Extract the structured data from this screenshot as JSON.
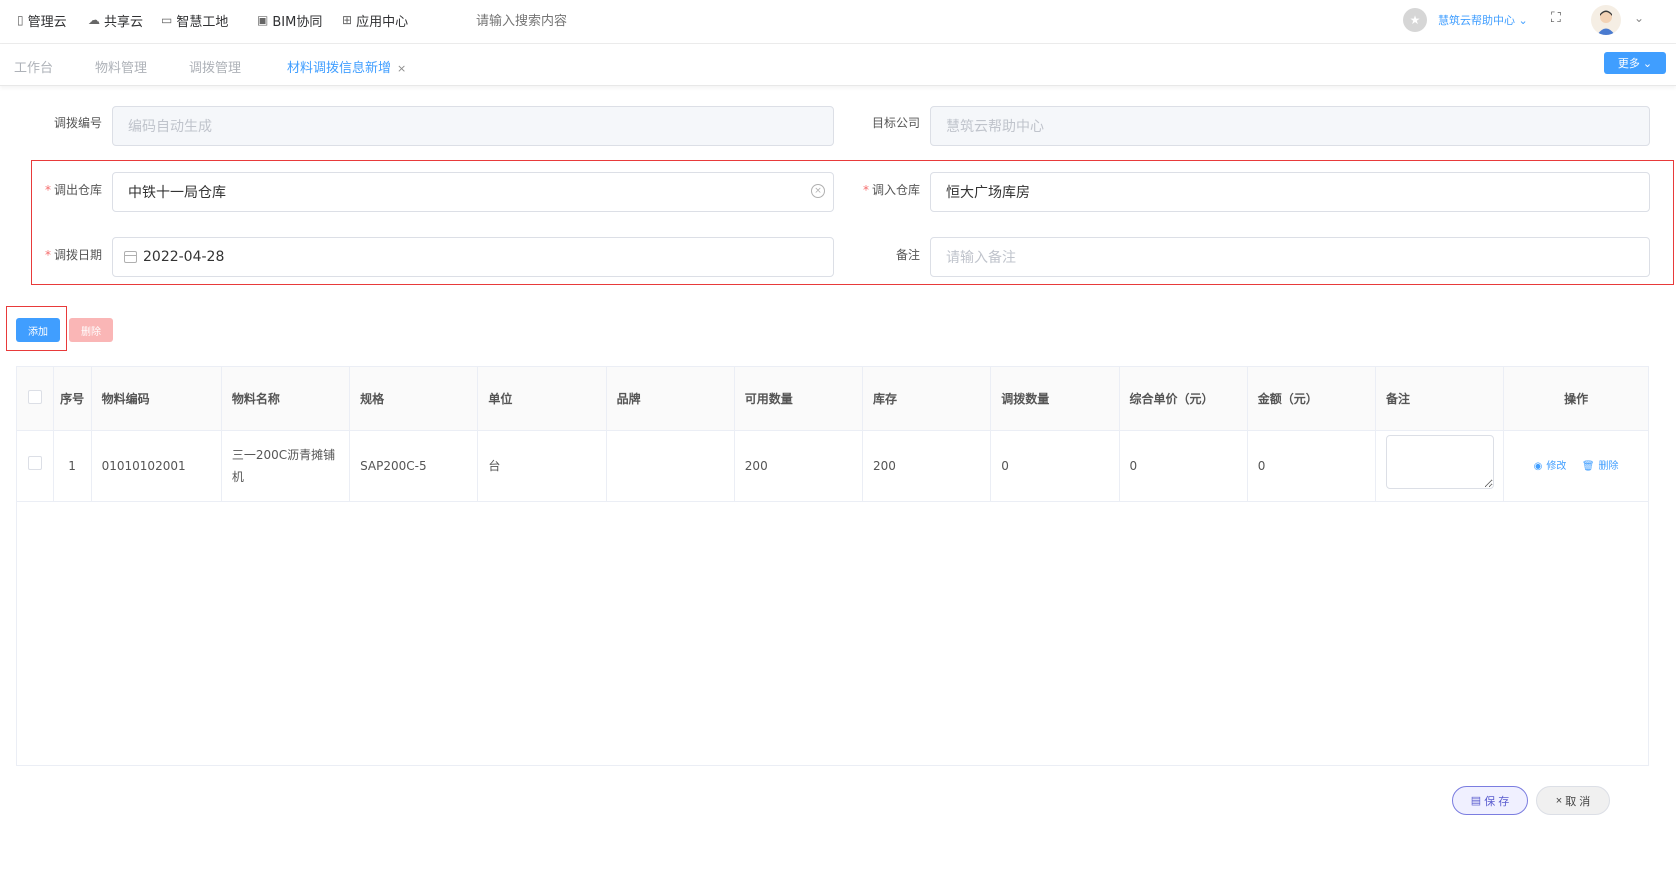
{
  "topnav": {
    "items": [
      {
        "label": "管理云",
        "icon": "phone-icon"
      },
      {
        "label": "共享云",
        "icon": "cloud-icon"
      },
      {
        "label": "智慧工地",
        "icon": "book-icon"
      },
      {
        "label": "BIM协同",
        "icon": "box-icon"
      },
      {
        "label": "应用中心",
        "icon": "grid-icon"
      }
    ],
    "search_placeholder": "请输入搜索内容",
    "org_name": "慧筑云帮助中心"
  },
  "tabs": [
    {
      "label": "工作台"
    },
    {
      "label": "物料管理"
    },
    {
      "label": "调拨管理"
    },
    {
      "label": "材料调拨信息新增",
      "active": true
    }
  ],
  "more_label": "更多",
  "form": {
    "code_label": "调拨编号",
    "code_placeholder": "编码自动生成",
    "target_company_label": "目标公司",
    "target_company_value": "慧筑云帮助中心",
    "out_warehouse_label": "调出仓库",
    "out_warehouse_value": "中铁十一局仓库",
    "in_warehouse_label": "调入仓库",
    "in_warehouse_value": "恒大广场库房",
    "date_label": "调拨日期",
    "date_value": "2022-04-28",
    "remark_label": "备注",
    "remark_placeholder": "请输入备注"
  },
  "buttons": {
    "add": "添加",
    "delete": "删除",
    "save": "保 存",
    "cancel": "取 消"
  },
  "table": {
    "headers": [
      "序号",
      "物料编码",
      "物料名称",
      "规格",
      "单位",
      "品牌",
      "可用数量",
      "库存",
      "调拨数量",
      "综合单价（元）",
      "金额（元）",
      "备注",
      "操作"
    ],
    "rows": [
      {
        "index": "1",
        "code": "01010102001",
        "name": "三一200C沥青摊铺机",
        "spec": "SAP200C-5",
        "unit": "台",
        "brand": "",
        "available": "200",
        "stock": "200",
        "qty": "0",
        "price": "0",
        "amount": "0"
      }
    ],
    "edit_label": "修改",
    "delete_label": "删除"
  },
  "colors": {
    "primary": "#409eff",
    "danger_light": "#fab6b6",
    "highlight_border": "#e83a3a"
  }
}
